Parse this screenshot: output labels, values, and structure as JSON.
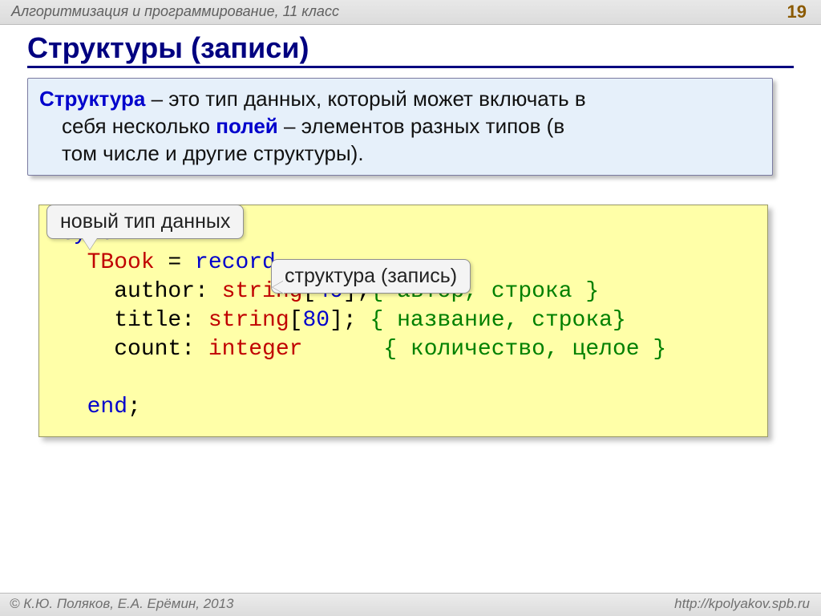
{
  "header": {
    "course": "Алгоритмизация и программирование, 11 класс",
    "page": "19"
  },
  "title": "Структуры (записи)",
  "definition": {
    "term": "Структура",
    "line1_after_term": " – это тип данных, который может включать в",
    "line2_pre": "себя несколько ",
    "fields_word": "полей",
    "line2_post": " – элементов разных типов (в",
    "line3": "том числе и другие структуры)."
  },
  "callouts": {
    "newtype": "новый тип данных",
    "record": "структура (запись)"
  },
  "code": {
    "l1_kw": "type",
    "l2_ident": "  TBook",
    "l2_eq": " = ",
    "l2_kw": "record",
    "l3_pre": "    author: ",
    "l3_type": "string",
    "l3_br1": "[",
    "l3_num": "40",
    "l3_br2": "];",
    "l3_comment": "{ автор, строка }",
    "l4_pre": "    title: ",
    "l4_type": "string",
    "l4_br1": "[",
    "l4_num": "80",
    "l4_br2": "]; ",
    "l4_comment": "{ название, строка}",
    "l5_pre": "    count: ",
    "l5_type": "integer",
    "l5_gap": "      ",
    "l5_comment": "{ количество, целое }",
    "l7_pre": "  ",
    "l7_kw": "end",
    "l7_semi": ";"
  },
  "footer": {
    "left": "© К.Ю. Поляков, Е.А. Ерёмин, 2013",
    "right": "http://kpolyakov.spb.ru"
  }
}
